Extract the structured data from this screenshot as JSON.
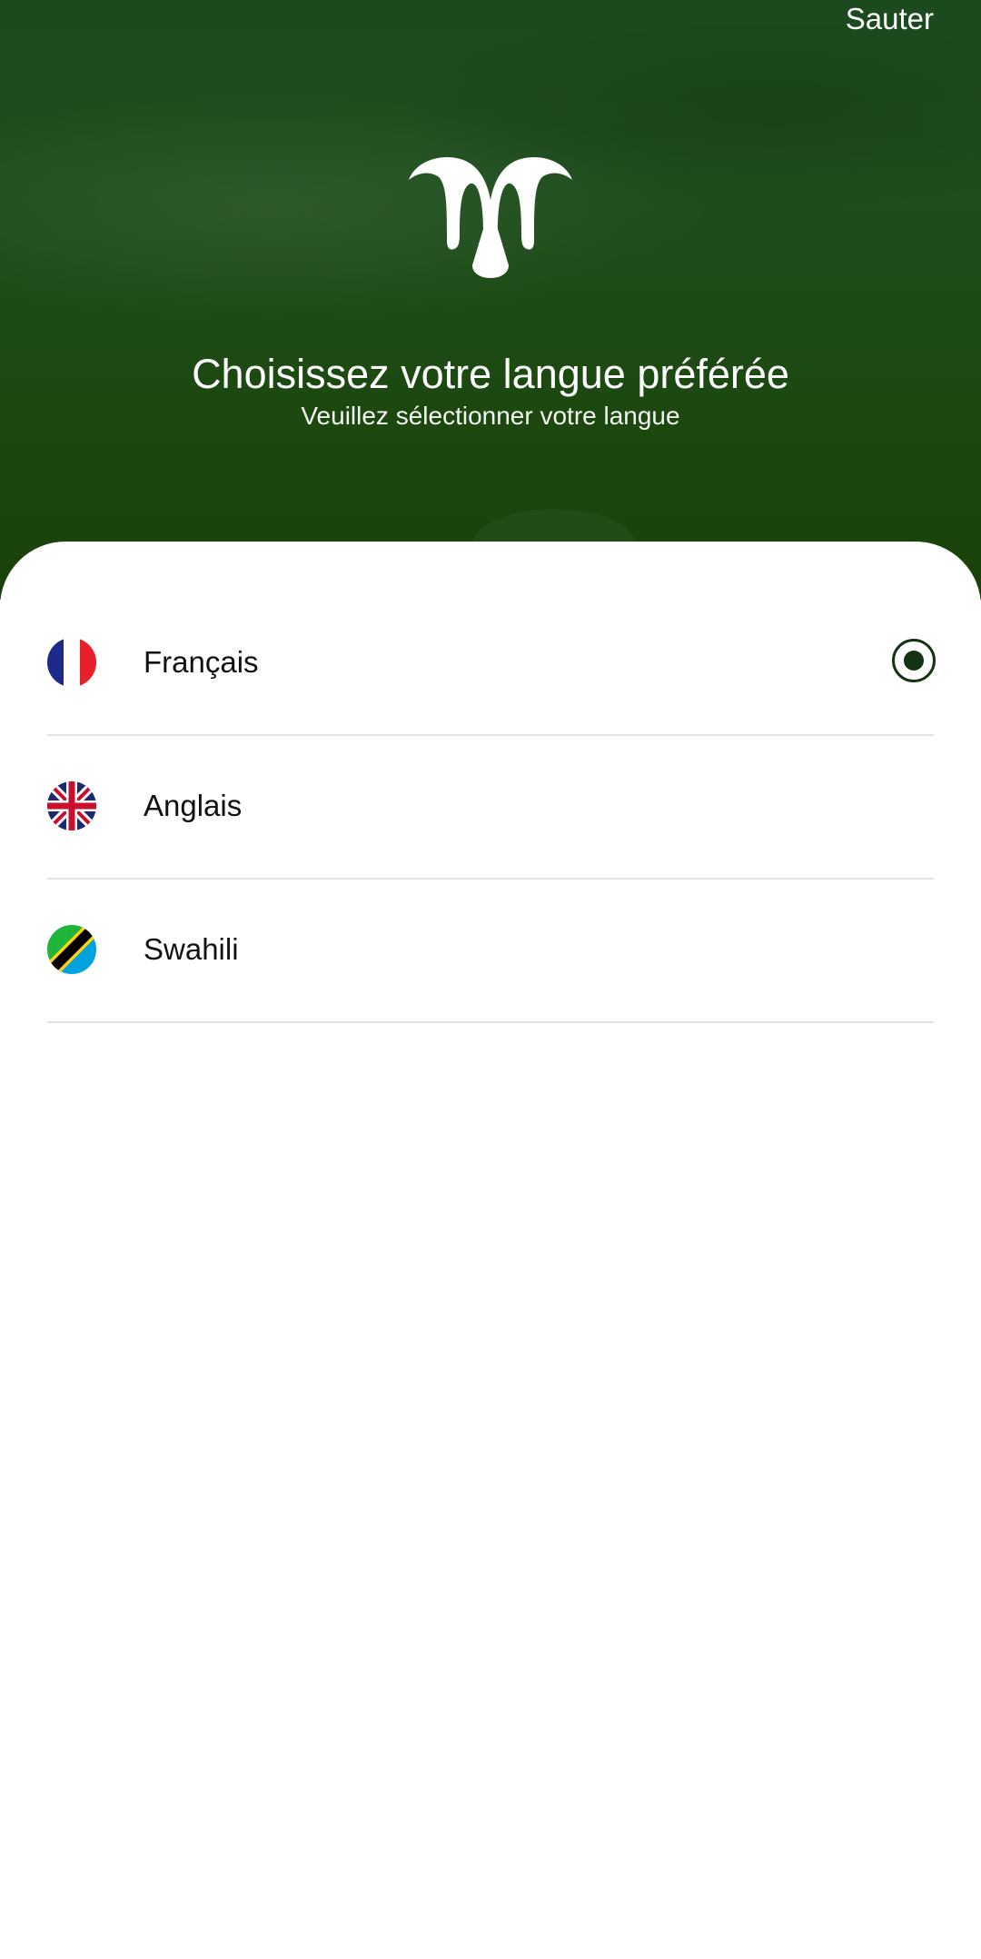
{
  "header": {
    "skip_label": "Sauter",
    "title": "Choisissez votre langue préférée",
    "subtitle": "Veuillez sélectionner votre langue",
    "logo_icon": "ram-horns-logo-icon",
    "background_color": "#1c4a14"
  },
  "languages": {
    "items": [
      {
        "label": "Français",
        "flag_icon": "france-flag-icon",
        "selected": true
      },
      {
        "label": "Anglais",
        "flag_icon": "uk-flag-icon",
        "selected": false
      },
      {
        "label": "Swahili",
        "flag_icon": "tanzania-flag-icon",
        "selected": false
      }
    ],
    "accent_color": "#133312"
  }
}
